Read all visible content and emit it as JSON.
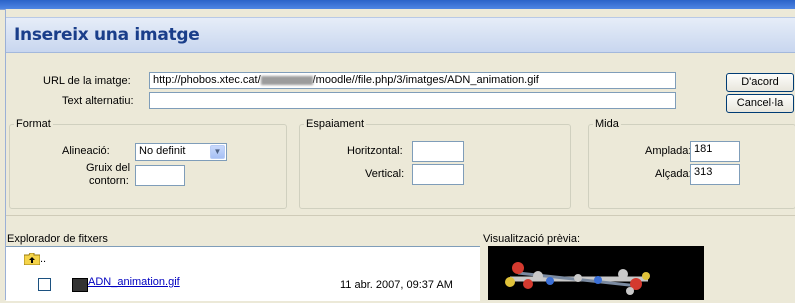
{
  "dialog": {
    "title": "Insereix una imatge",
    "url_label": "URL de la imatge:",
    "url_prefix": "http://phobos.xtec.cat/",
    "url_suffix": "/moodle//file.php/3/imatges/ADN_animation.gif",
    "alt_label": "Text alternatiu:",
    "alt_value": "",
    "ok_button": "D'acord",
    "cancel_button": "Cancel·la"
  },
  "format": {
    "title": "Format",
    "align_label": "Alineació:",
    "align_value": "No definit",
    "border_label_1": "Gruix del",
    "border_label_2": "contorn:",
    "border_value": ""
  },
  "spacing": {
    "title": "Espaiament",
    "horizontal_label": "Horitzontal:",
    "horizontal_value": "",
    "vertical_label": "Vertical:",
    "vertical_value": ""
  },
  "size": {
    "title": "Mida",
    "width_label": "Amplada:",
    "width_value": "181",
    "height_label": "Alçada:",
    "height_value": "313"
  },
  "explorer": {
    "title": "Explorador de fitxers",
    "parent_label": "..",
    "files": [
      {
        "name": "ADN_animation.gif",
        "date": "11 abr. 2007, 09:37 AM"
      }
    ]
  },
  "preview": {
    "title": "Visualització prèvia:"
  },
  "icons": {
    "dropdown": "chevron-down-icon",
    "folder": "folder-up-icon",
    "file": "image-file-icon"
  }
}
